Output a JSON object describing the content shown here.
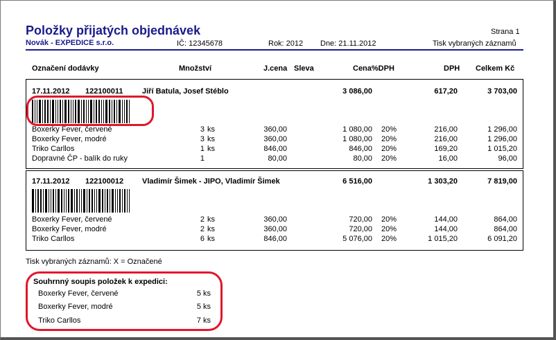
{
  "header": {
    "title": "Položky přijatých objednávek",
    "company": "Novák - EXPEDICE s.r.o.",
    "ic": "IČ: 12345678",
    "year": "Rok: 2012",
    "date": "Dne: 21.11.2012",
    "page": "Strana 1",
    "print_mode": "Tisk vybraných záznamů"
  },
  "columns": {
    "designation": "Označení dodávky",
    "quantity": "Množství",
    "unit_price": "J.cena",
    "discount": "Sleva",
    "price": "Cena%DPH",
    "vat": "DPH",
    "total": "Celkem Kč"
  },
  "orders": [
    {
      "date": "17.11.2012",
      "number": "122100011",
      "customer": "Jiří Batula, Josef Stéblo",
      "price": "3 086,00",
      "vat": "617,20",
      "total": "3 703,00",
      "items": [
        {
          "name": "Boxerky Fever, červené",
          "qty": "3",
          "unit": "ks",
          "unit_price": "360,00",
          "price": "1 080,00",
          "vat_rate": "20%",
          "vat": "216,00",
          "total": "1 296,00"
        },
        {
          "name": "Boxerky Fever, modré",
          "qty": "3",
          "unit": "ks",
          "unit_price": "360,00",
          "price": "1 080,00",
          "vat_rate": "20%",
          "vat": "216,00",
          "total": "1 296,00"
        },
        {
          "name": "Triko Carllos",
          "qty": "1",
          "unit": "ks",
          "unit_price": "846,00",
          "price": "846,00",
          "vat_rate": "20%",
          "vat": "169,20",
          "total": "1 015,20"
        },
        {
          "name": "Dopravné ČP - balík do ruky",
          "qty": "1",
          "unit": "",
          "unit_price": "80,00",
          "price": "80,00",
          "vat_rate": "20%",
          "vat": "16,00",
          "total": "96,00"
        }
      ]
    },
    {
      "date": "17.11.2012",
      "number": "122100012",
      "customer": "Vladimír Šimek - JIPO, Vladimír Šimek",
      "price": "6 516,00",
      "vat": "1 303,20",
      "total": "7 819,00",
      "items": [
        {
          "name": "Boxerky Fever, červené",
          "qty": "2",
          "unit": "ks",
          "unit_price": "360,00",
          "price": "720,00",
          "vat_rate": "20%",
          "vat": "144,00",
          "total": "864,00"
        },
        {
          "name": "Boxerky Fever, modré",
          "qty": "2",
          "unit": "ks",
          "unit_price": "360,00",
          "price": "720,00",
          "vat_rate": "20%",
          "vat": "144,00",
          "total": "864,00"
        },
        {
          "name": "Triko Carllos",
          "qty": "6",
          "unit": "ks",
          "unit_price": "846,00",
          "price": "5 076,00",
          "vat_rate": "20%",
          "vat": "1 015,20",
          "total": "6 091,20"
        }
      ]
    }
  ],
  "note": "Tisk vybraných záznamů: X = Označené",
  "summary": {
    "title": "Souhrnný soupis položek k expedici:",
    "items": [
      {
        "name": "Boxerky Fever, červené",
        "qty": "5 ks"
      },
      {
        "name": "Boxerky Fever, modré",
        "qty": "5 ks"
      },
      {
        "name": "Triko Carllos",
        "qty": "7 ks"
      }
    ]
  },
  "colors": {
    "title": "#1a1a8c",
    "highlight": "#e0162b"
  }
}
